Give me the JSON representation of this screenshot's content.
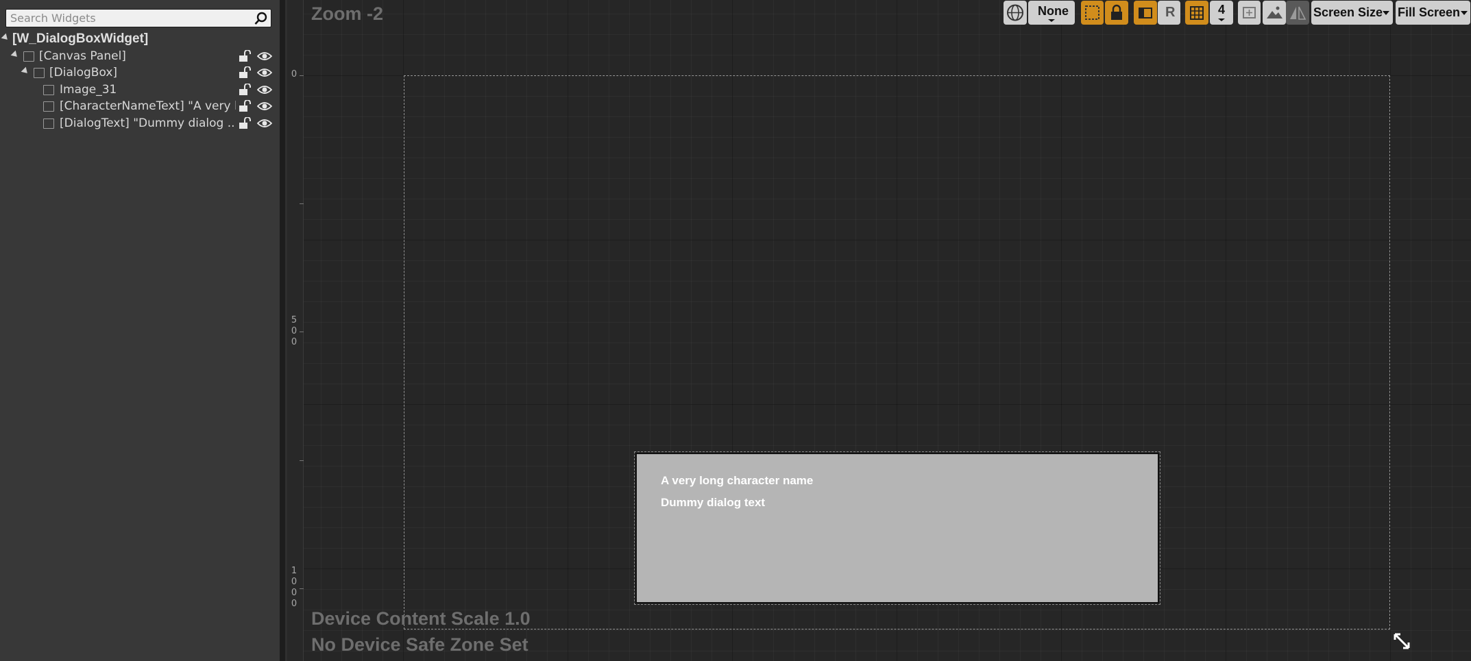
{
  "hierarchy": {
    "search_placeholder": "Search Widgets",
    "root": "[W_DialogBoxWidget]",
    "items": [
      {
        "label": "[Canvas Panel]"
      },
      {
        "label": "[DialogBox]"
      },
      {
        "label": "Image_31"
      },
      {
        "label": "[CharacterNameText] \"A very long character name\""
      },
      {
        "label": "[DialogText] \"Dummy dialog ..\""
      }
    ]
  },
  "toolbar": {
    "localization": "None",
    "respect_locks_label": "R",
    "grid_snap_value": "4",
    "screen_size": "Screen Size",
    "fill_mode": "Fill Screen"
  },
  "designer": {
    "zoom": "Zoom -2",
    "ruler_labels": [
      "0",
      "5",
      "0",
      "0",
      "1",
      "0",
      "0",
      "0"
    ],
    "device_scale": "Device Content Scale 1.0",
    "safe_zone": "No Device Safe Zone Set"
  },
  "dialog_preview": {
    "character_name": "A very long character name",
    "dialog_text": "Dummy dialog text"
  },
  "colors": {
    "accent": "#d18d1c",
    "panel": "#383838",
    "canvas": "#262626",
    "dialog_bg": "#b5b5b5"
  }
}
